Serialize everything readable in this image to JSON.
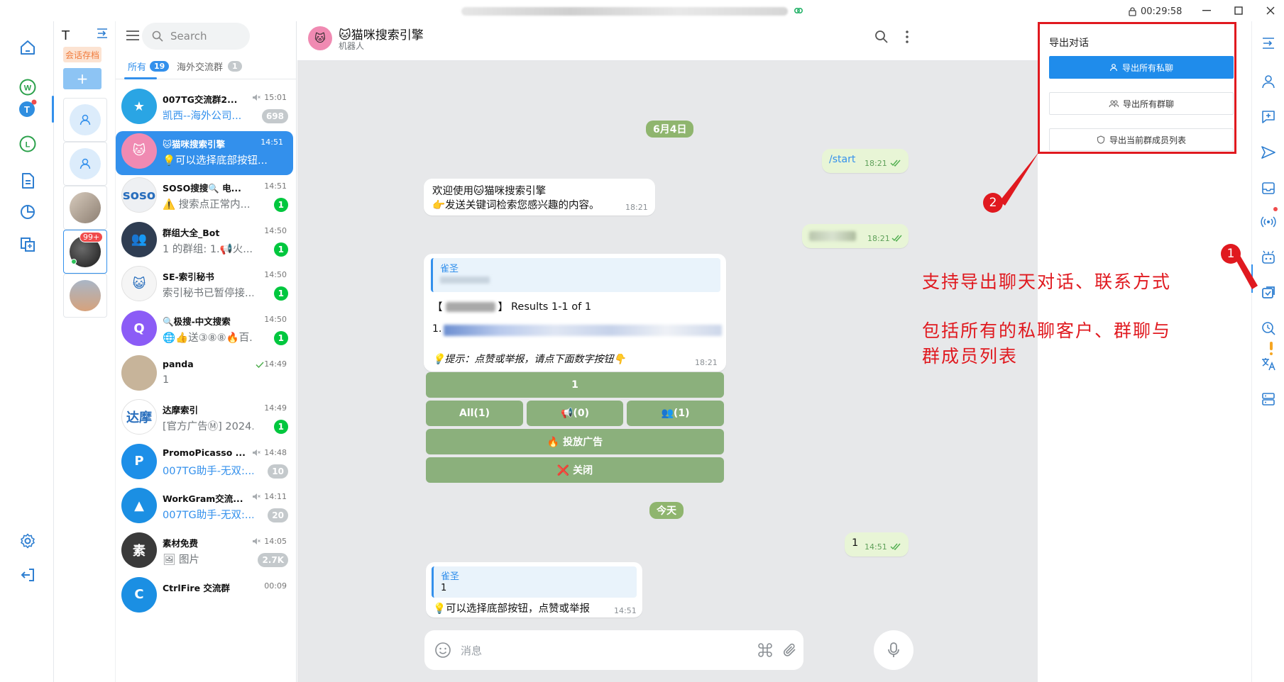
{
  "titlebar": {
    "clock": "00:29:58"
  },
  "accounts": {
    "letter": "T",
    "tag": "会话存档",
    "add": "+",
    "unread_badge": "99+"
  },
  "search": {
    "placeholder": "Search"
  },
  "tabs": [
    {
      "label": "所有",
      "count": "19"
    },
    {
      "label": "海外交流群",
      "count": "1"
    }
  ],
  "chats": [
    {
      "name": "007TG交流群2...",
      "time": "15:01",
      "preview": "凯西--海外公司...",
      "badge": "698",
      "badge_style": "gray",
      "preview_style": "blue",
      "muted": true,
      "avatar_color": "#2aa5e4",
      "avatar_text": "★"
    },
    {
      "name": "🐱猫咪搜索引擎",
      "time": "14:51",
      "preview": "💡可以选择底部按钮...",
      "badge": "",
      "active": true,
      "avatar_color": "#f08ab2",
      "avatar_text": "🐱"
    },
    {
      "name": "SOSO搜搜🔍 电...",
      "time": "14:51",
      "preview": "⚠️ 搜索点正常内...",
      "badge": "1",
      "avatar_color": "#eef0f3",
      "avatar_text": "soso"
    },
    {
      "name": "群组大全_Bot",
      "time": "14:50",
      "preview": "1 的群组:  1.📢火...",
      "badge": "1",
      "avatar_color": "#2f3d52",
      "avatar_text": "👥"
    },
    {
      "name": "SE-索引秘书",
      "time": "14:50",
      "preview": "索引秘书已暂停接...",
      "badge": "1",
      "avatar_color": "#f5f5f5",
      "avatar_text": "😺"
    },
    {
      "name": "🔍极搜-中文搜索",
      "time": "14:50",
      "preview": "🌐👍送③⑧⑧🔥百...",
      "badge": "1",
      "avatar_color": "#8b5cf6",
      "avatar_text": "Q"
    },
    {
      "name": "panda",
      "time": "14:49",
      "preview": "1",
      "badge": "",
      "read": true,
      "avatar_color": "#c7b49a",
      "avatar_text": ""
    },
    {
      "name": "达摩索引",
      "time": "14:49",
      "preview": "[官方广告Ⓜ] 2024...",
      "badge": "1",
      "avatar_color": "#ffffff",
      "avatar_text": "达摩"
    },
    {
      "name": "PromoPicasso ...",
      "time": "14:48",
      "preview": "007TG助手-无双:...",
      "badge": "10",
      "badge_style": "gray",
      "preview_style": "blue",
      "muted": true,
      "avatar_color": "#1d8fe8",
      "avatar_text": "P"
    },
    {
      "name": "WorkGram交流...",
      "time": "14:11",
      "preview": "007TG助手-无双:...",
      "badge": "20",
      "badge_style": "gray",
      "preview_style": "blue",
      "muted": true,
      "avatar_color": "#1b8fe3",
      "avatar_text": "▲"
    },
    {
      "name": "素材免费",
      "time": "14:05",
      "preview": "🖼 图片",
      "badge": "2.7K",
      "badge_style": "gray",
      "muted": true,
      "avatar_color": "#3a3a3a",
      "avatar_text": "素"
    },
    {
      "name": "CtrlFire 交流群",
      "time": "00:09",
      "preview": "",
      "badge": "",
      "avatar_color": "#1b8fe3",
      "avatar_text": "C"
    }
  ],
  "header": {
    "avatar": "🐱",
    "title": "🐱猫咪搜索引擎",
    "subtitle": "机器人"
  },
  "messages": {
    "date1": "6月4日",
    "start": {
      "text": "/start",
      "time": "18:21"
    },
    "welcome": {
      "line1": "欢迎使用🐱猫咪搜索引擎",
      "line2": "👉发送关键词检索您感兴趣的内容。",
      "time": "18:21"
    },
    "hidden_out": {
      "time": "18:21"
    },
    "result": {
      "reply_name": "雀圣",
      "results": "Results 1-1 of 1",
      "item_no": "1.",
      "tip": "💡提示：点赞或举报，请点下面数字按钮👇",
      "time": "18:21"
    },
    "keyboard": {
      "row1": "1",
      "all": "All(1)",
      "ch": "📢(0)",
      "grp": "👥(1)",
      "ad": "🔥 投放广告",
      "close": "❌ 关闭"
    },
    "date2": "今天",
    "one": {
      "text": "1",
      "time": "14:51"
    },
    "reply": {
      "reply_name": "雀圣",
      "reply_text": "1",
      "text": "💡可以选择底部按钮，点赞或举报",
      "time": "14:51"
    }
  },
  "composer": {
    "placeholder": "消息"
  },
  "export": {
    "title": "导出对话",
    "btn_private": "导出所有私聊",
    "btn_groups": "导出所有群聊",
    "btn_members": "导出当前群成员列表"
  },
  "annotation": {
    "num1": "1",
    "num2": "2",
    "line1": "支持导出聊天对话、联系方式",
    "line2": "包括所有的私聊客户、群聊与",
    "line3": "群成员列表"
  },
  "colors": {
    "accent": "#3390ec",
    "unread": "#00c73e",
    "annotation": "#e0191f",
    "keyboard": "#8bb07c",
    "outgoing": "#e8f5d6"
  }
}
